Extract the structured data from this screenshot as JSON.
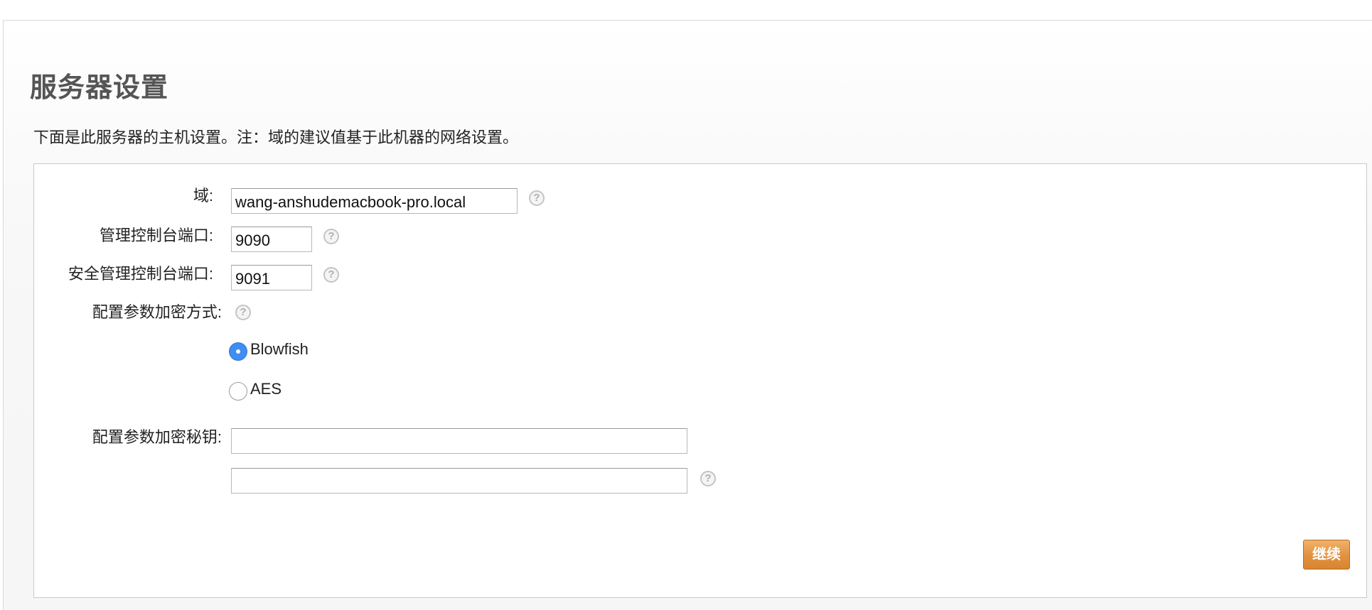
{
  "page": {
    "title": "服务器设置",
    "description": "下面是此服务器的主机设置。注：域的建议值基于此机器的网络设置。"
  },
  "form": {
    "domain": {
      "label": "域:",
      "value": "wang-anshudemacbook-pro.local"
    },
    "admin_console_port": {
      "label": "管理控制台端口:",
      "value": "9090"
    },
    "secure_admin_console_port": {
      "label": "安全管理控制台端口:",
      "value": "9091"
    },
    "encryption_method": {
      "label": "配置参数加密方式:",
      "options": [
        {
          "label": "Blowfish",
          "selected": true
        },
        {
          "label": "AES",
          "selected": false
        }
      ]
    },
    "encryption_key": {
      "label": "配置参数加密秘钥:",
      "value": "",
      "confirm_value": ""
    },
    "help_icon": "?"
  },
  "actions": {
    "continue_label": "继续"
  },
  "colors": {
    "radio_selected": "#3f8ef2",
    "continue_button": "#e1913f",
    "title_text": "#555555"
  }
}
